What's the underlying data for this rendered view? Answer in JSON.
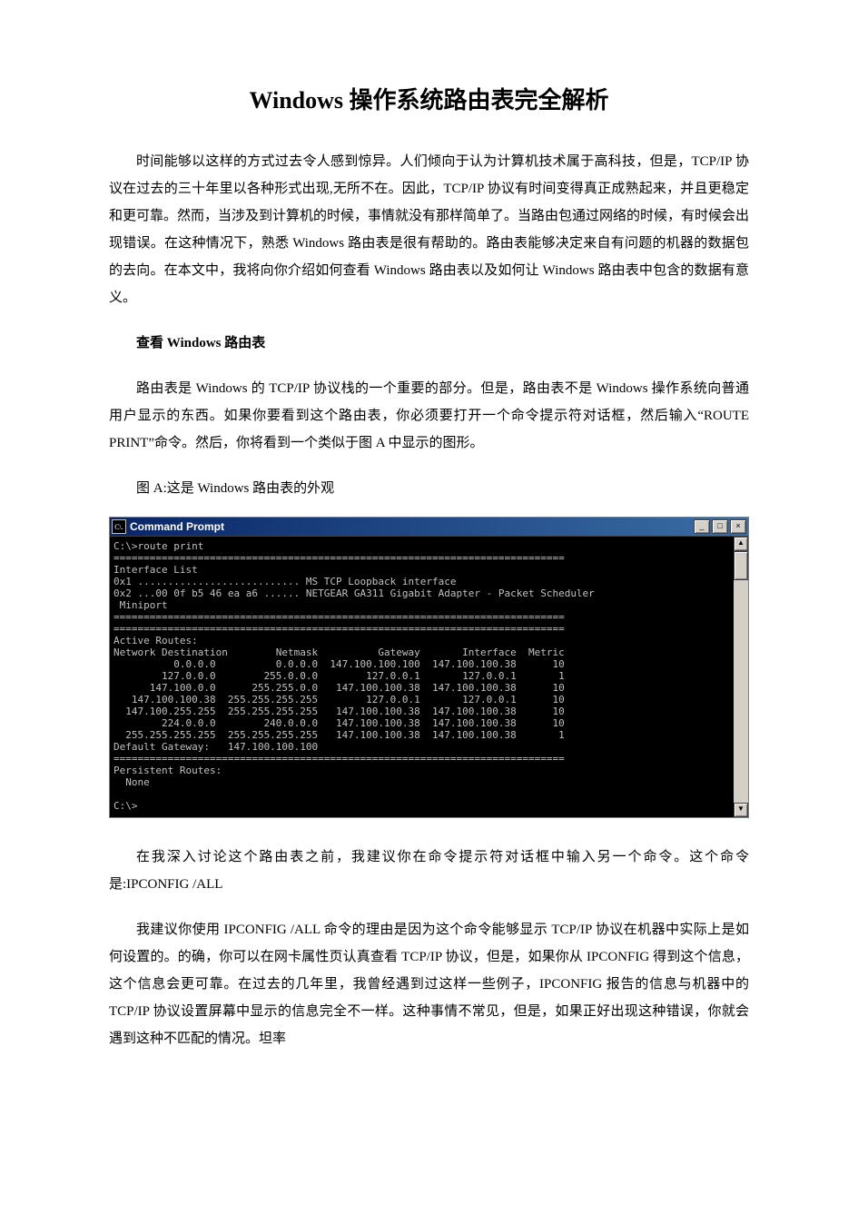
{
  "title": "Windows 操作系统路由表完全解析",
  "p1": "时间能够以这样的方式过去令人感到惊异。人们倾向于认为计算机技术属于高科技，但是，TCP/IP 协议在过去的三十年里以各种形式出现,无所不在。因此，TCP/IP 协议有时间变得真正成熟起来，并且更稳定和更可靠。然而，当涉及到计算机的时候，事情就没有那样简单了。当路由包通过网络的时候，有时候会出现错误。在这种情况下，熟悉 Windows 路由表是很有帮助的。路由表能够决定来自有问题的机器的数据包的去向。在本文中，我将向你介绍如何查看 Windows 路由表以及如何让 Windows 路由表中包含的数据有意义。",
  "h1": "查看 Windows 路由表",
  "p2": "路由表是 Windows 的 TCP/IP 协议栈的一个重要的部分。但是，路由表不是 Windows 操作系统向普通用户显示的东西。如果你要看到这个路由表，你必须要打开一个命令提示符对话框，然后输入“ROUTE PRINT”命令。然后，你将看到一个类似于图 A 中显示的图形。",
  "caption": "图 A:这是 Windows 路由表的外观",
  "cmd": {
    "title": "Command Prompt",
    "icon_text": "C\\.",
    "min_label": "_",
    "max_label": "□",
    "close_label": "×",
    "up_label": "▲",
    "down_label": "▼",
    "output": "C:\\>route print\n===========================================================================\nInterface List\n0x1 ........................... MS TCP Loopback interface\n0x2 ...00 0f b5 46 ea a6 ...... NETGEAR GA311 Gigabit Adapter - Packet Scheduler\n Miniport\n===========================================================================\n===========================================================================\nActive Routes:\nNetwork Destination        Netmask          Gateway       Interface  Metric\n          0.0.0.0          0.0.0.0  147.100.100.100  147.100.100.38      10\n        127.0.0.0        255.0.0.0        127.0.0.1       127.0.0.1       1\n      147.100.0.0      255.255.0.0   147.100.100.38  147.100.100.38      10\n   147.100.100.38  255.255.255.255        127.0.0.1       127.0.0.1      10\n  147.100.255.255  255.255.255.255   147.100.100.38  147.100.100.38      10\n        224.0.0.0        240.0.0.0   147.100.100.38  147.100.100.38      10\n  255.255.255.255  255.255.255.255   147.100.100.38  147.100.100.38       1\nDefault Gateway:   147.100.100.100\n===========================================================================\nPersistent Routes:\n  None\n\nC:\\>"
  },
  "p3": "在我深入讨论这个路由表之前，我建议你在命令提示符对话框中输入另一个命令。这个命令是:IPCONFIG /ALL",
  "p4": "我建议你使用 IPCONFIG /ALL 命令的理由是因为这个命令能够显示 TCP/IP 协议在机器中实际上是如何设置的。的确，你可以在网卡属性页认真查看 TCP/IP 协议，但是，如果你从 IPCONFIG 得到这个信息，这个信息会更可靠。在过去的几年里，我曾经遇到过这样一些例子，IPCONFIG 报告的信息与机器中的 TCP/IP 协议设置屏幕中显示的信息完全不一样。这种事情不常见，但是，如果正好出现这种错误，你就会遇到这种不匹配的情况。坦率"
}
